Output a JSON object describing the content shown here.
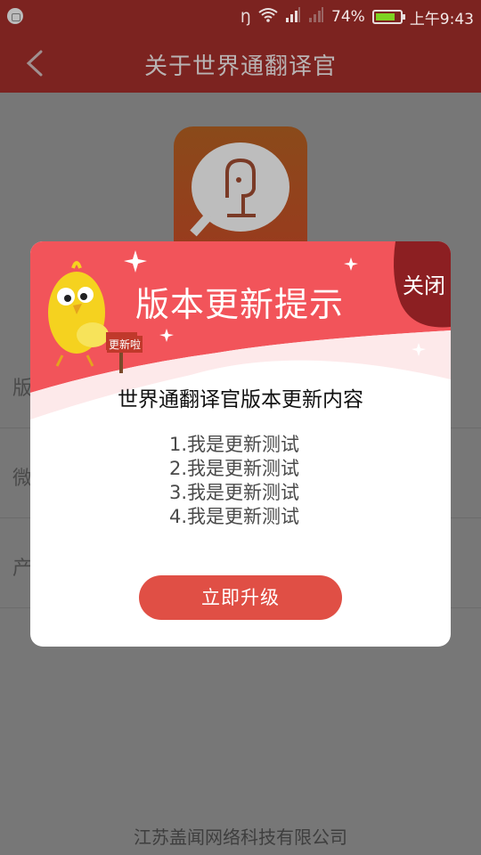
{
  "status_bar": {
    "battery_percent": "74%",
    "battery_level": 0.74,
    "time": "上午9:43"
  },
  "header": {
    "title": "关于世界通翻译官"
  },
  "page": {
    "rows": [
      {
        "label": "版"
      },
      {
        "label": "微"
      },
      {
        "label": "产"
      }
    ],
    "company": "江苏盖闻网络科技有限公司"
  },
  "dialog": {
    "banner_title": "版本更新提示",
    "close_label": "关闭",
    "sign_text": "更新啦",
    "content_title": "世界通翻译官版本更新内容",
    "updates": [
      "1.我是更新测试",
      "2.我是更新测试",
      "3.我是更新测试",
      "4.我是更新测试"
    ],
    "upgrade_label": "立即升级"
  }
}
